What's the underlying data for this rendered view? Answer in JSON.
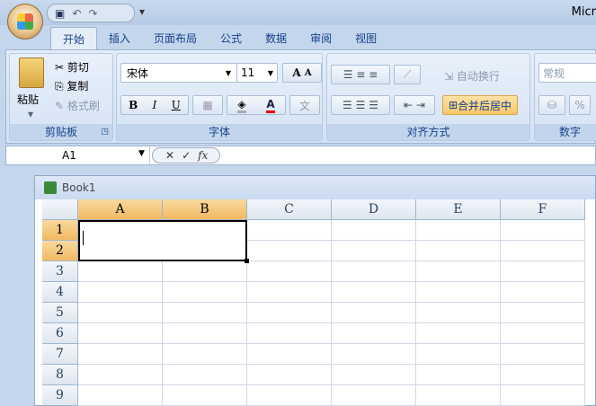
{
  "app_title": "Micr",
  "tabs": [
    "开始",
    "插入",
    "页面布局",
    "公式",
    "数据",
    "审阅",
    "视图"
  ],
  "clipboard": {
    "paste": "粘贴",
    "cut": "剪切",
    "copy": "复制",
    "format_painter": "格式刷",
    "label": "剪贴板"
  },
  "font": {
    "name": "宋体",
    "size": "11",
    "bold": "B",
    "italic": "I",
    "underline": "U",
    "grow": "A",
    "shrink": "A",
    "font_color": "A",
    "phonetic": "文",
    "label": "字体"
  },
  "alignment": {
    "wrap": "自动换行",
    "merge": "合并后居中",
    "label": "对齐方式"
  },
  "number": {
    "format": "常规",
    "percent": "%",
    "label": "数字"
  },
  "formula_bar": {
    "name_box": "A1",
    "cancel": "✕",
    "enter": "✓",
    "fx": "fx",
    "value": ""
  },
  "workbook": {
    "title": "Book1",
    "columns": [
      "A",
      "B",
      "C",
      "D",
      "E",
      "F"
    ],
    "rows": [
      "1",
      "2",
      "3",
      "4",
      "5",
      "6",
      "7",
      "8",
      "9"
    ],
    "selected_range": "A1:B2"
  }
}
